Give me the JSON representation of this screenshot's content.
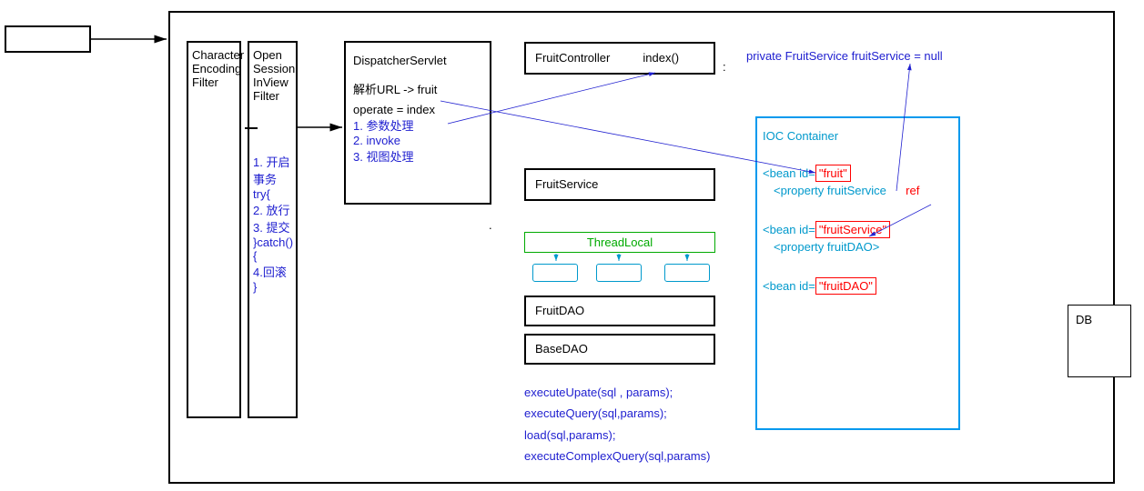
{
  "external_box": "",
  "main_container": "",
  "filters": {
    "char_encoding": {
      "l1": "Character",
      "l2": "Encoding",
      "l3": "Filter"
    },
    "open_session": {
      "l1": "Open",
      "l2": "Session",
      "l3": "InView",
      "l4": "Filter"
    },
    "osiv_notes": {
      "n1": "1. 开启事务",
      "n2": "try{",
      "n3": "2. 放行",
      "n4": "3. 提交",
      "n5": "}catch(){",
      "n6": "4.回滚",
      "n7": "}"
    }
  },
  "dispatcher": {
    "title": "DispatcherServlet",
    "line1": "解析URL -> fruit",
    "line2": "operate = index",
    "s1": "1. 参数处理",
    "s2": "2. invoke",
    "s3": "3. 视图处理"
  },
  "controller": {
    "name": "FruitController",
    "method": "index()"
  },
  "private_field": "private FruitService fruitService = null",
  "service": {
    "name": "FruitService"
  },
  "threadlocal": {
    "title": "ThreadLocal"
  },
  "dao": {
    "name": "FruitDAO"
  },
  "basedao": {
    "name": "BaseDAO"
  },
  "dao_methods": {
    "m1": "executeUpate(sql , params);",
    "m2": "executeQuery(sql,params);",
    "m3": "load(sql,params);",
    "m4": "executeComplexQuery(sql,params)"
  },
  "ioc": {
    "title": "IOC Container",
    "bean1_prefix": "<bean id=",
    "bean1_id": "\"fruit\"",
    "bean1_prop": "<property fruitService",
    "bean1_ref": "ref",
    "bean2_prefix": "<bean id=",
    "bean2_id": "\"fruitService\"",
    "bean2_prop": "<property fruitDAO>",
    "bean3_prefix": "<bean id=",
    "bean3_id": "\"fruitDAO\""
  },
  "db": {
    "label": "DB"
  },
  "dot": "."
}
